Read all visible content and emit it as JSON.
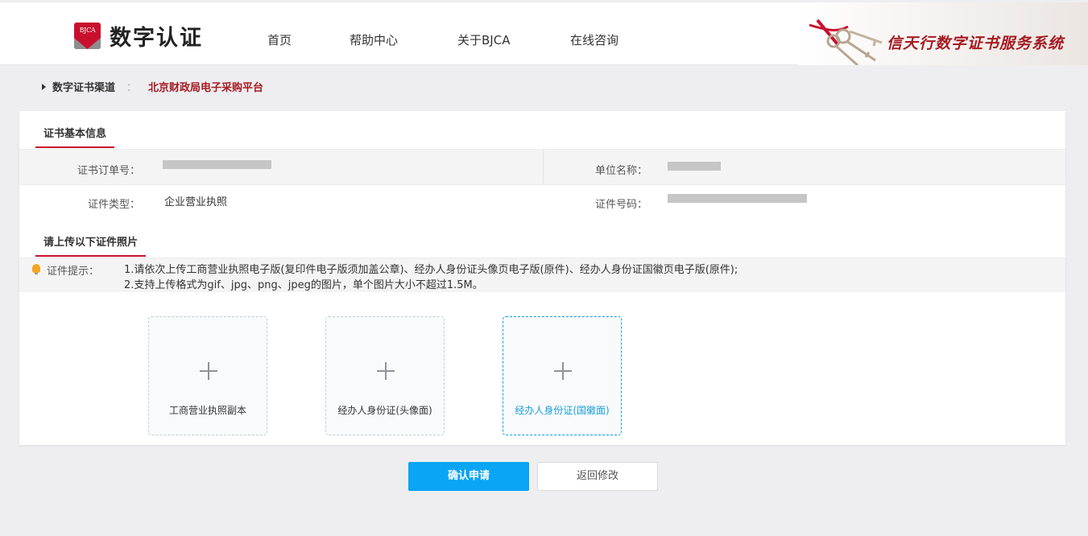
{
  "header": {
    "logo_badge": "BJCA",
    "logo_text": "数字认证",
    "nav": [
      "首页",
      "帮助中心",
      "关于BJCA",
      "在线咨询"
    ],
    "banner_text": "信天行数字证书服务系统"
  },
  "breadcrumb": {
    "label": "数字证书渠道",
    "separator": "：",
    "channel": "北京财政局电子采购平台"
  },
  "cert_info": {
    "title": "证书基本信息",
    "order_label": "证书订单号：",
    "org_label": "单位名称：",
    "id_type_label": "证件类型：",
    "id_type_value": "企业营业执照",
    "id_number_label": "证件号码："
  },
  "upload_section": {
    "title": "请上传以下证件照片",
    "tip_label": "证件提示：",
    "tip_line1": "1.请依次上传工商营业执照电子版(复印件电子版须加盖公章)、经办人身份证头像页电子版(原件)、经办人身份证国徽页电子版(原件);",
    "tip_line2": "2.支持上传格式为gif、jpg、png、jpeg的图片，单个图片大小不超过1.5M。",
    "slots": [
      "工商营业执照副本",
      "经办人身份证(头像面)",
      "经办人身份证(国徽面)"
    ]
  },
  "actions": {
    "confirm": "确认申请",
    "back": "返回修改"
  },
  "colors": {
    "brand_red": "#c8102e",
    "primary_blue": "#0aa5f5",
    "active_blue": "#1a9dd9"
  }
}
